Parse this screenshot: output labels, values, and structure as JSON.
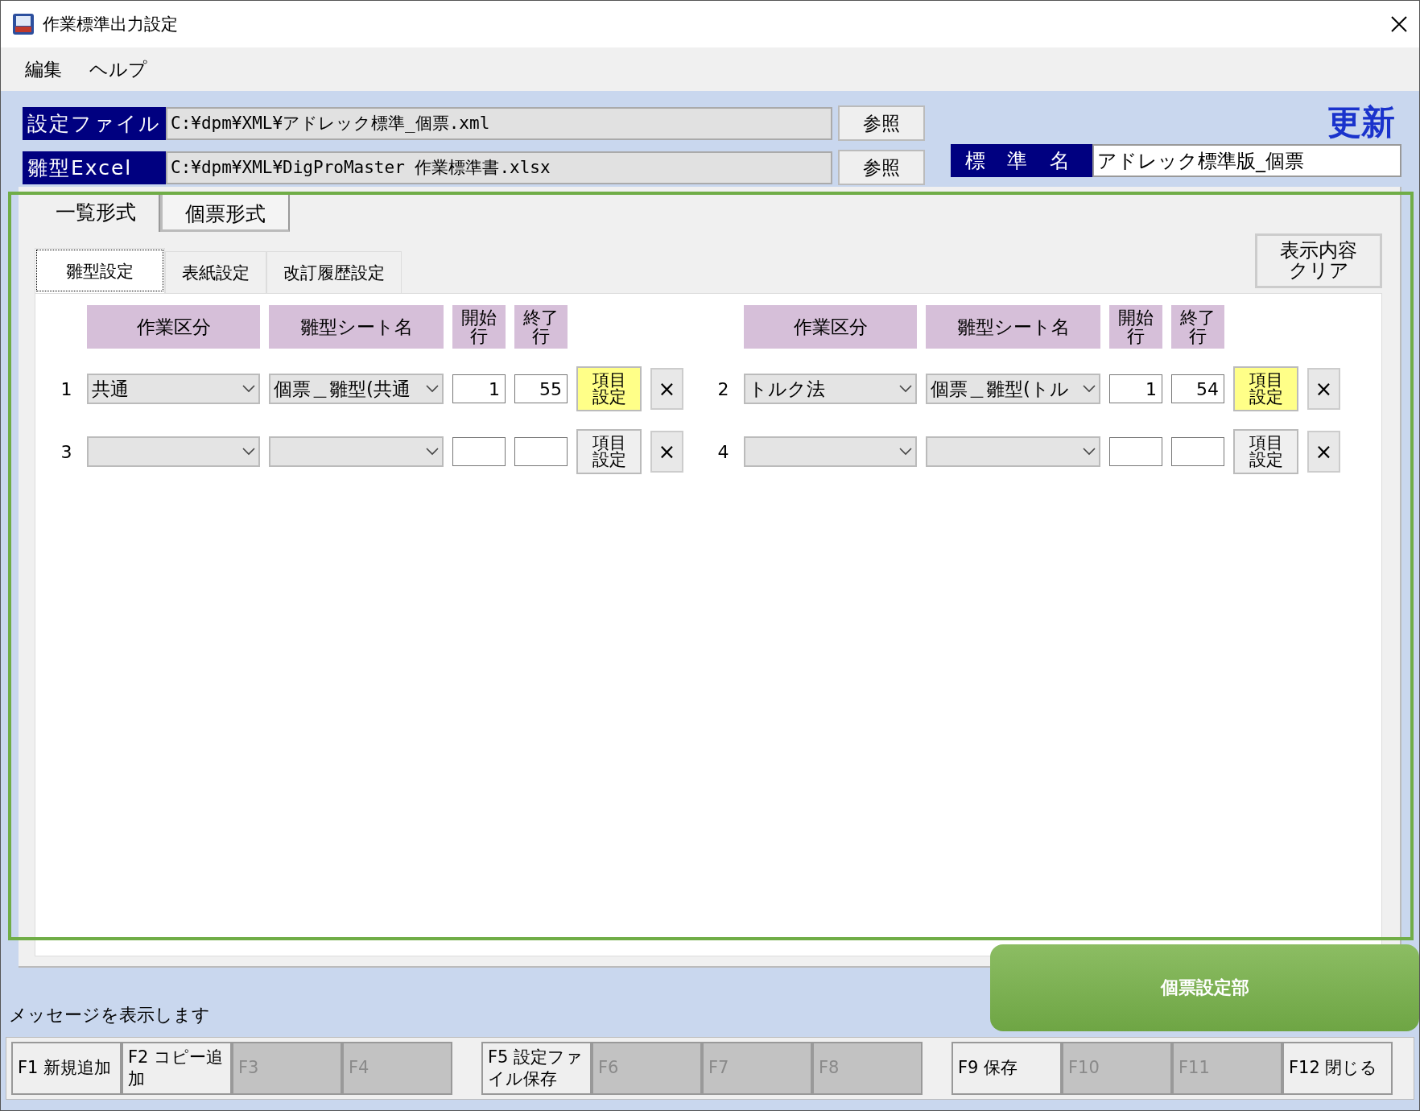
{
  "window": {
    "title": "作業標準出力設定"
  },
  "menu": [
    "編集",
    "ヘルプ"
  ],
  "file_rows": [
    {
      "label": "設定ファイル",
      "value": "C:¥dpm¥XML¥アドレック標準_個票.xml",
      "button": "参照"
    },
    {
      "label": "雛型Excel",
      "value": "C:¥dpm¥XML¥DigProMaster 作業標準書.xlsx",
      "button": "参照"
    }
  ],
  "update_label": "更新",
  "standard_name": {
    "label": "標 準 名",
    "value": "アドレック標準版_個票"
  },
  "view_tabs": [
    {
      "label": "一覧形式",
      "selected": false
    },
    {
      "label": "個票形式",
      "selected": true
    }
  ],
  "sub_tabs": [
    {
      "label": "雛型設定",
      "selected": true
    },
    {
      "label": "表紙設定",
      "selected": false
    },
    {
      "label": "改訂履歴設定",
      "selected": false
    }
  ],
  "clear_button": "表示内容クリア",
  "panels": [
    {
      "headers": [
        "作業区分",
        "雛型シート名",
        "開始行",
        "終了行"
      ],
      "rows": [
        {
          "number": "1",
          "category": "共通",
          "sheet": "個票＿雛型(共通",
          "start": "1",
          "end": "55",
          "item_button": "項目設定",
          "highlighted": true,
          "delete": "×"
        },
        {
          "number": "3",
          "category": "",
          "sheet": "",
          "start": "",
          "end": "",
          "item_button": "項目設定",
          "highlighted": false,
          "delete": "×"
        }
      ]
    },
    {
      "headers": [
        "作業区分",
        "雛型シート名",
        "開始行",
        "終了行"
      ],
      "rows": [
        {
          "number": "2",
          "category": "トルク法",
          "sheet": "個票＿雛型(トル",
          "start": "1",
          "end": "54",
          "item_button": "項目設定",
          "highlighted": true,
          "delete": "×"
        },
        {
          "number": "4",
          "category": "",
          "sheet": "",
          "start": "",
          "end": "",
          "item_button": "項目設定",
          "highlighted": false,
          "delete": "×"
        }
      ]
    }
  ],
  "message": "メッセージを表示します",
  "callout": "個票設定部",
  "function_key_groups": [
    [
      {
        "label": "F1 新規追加",
        "disabled": false
      },
      {
        "label": "F2 コピー追加",
        "disabled": false
      },
      {
        "label": "F3",
        "disabled": true
      },
      {
        "label": "F4",
        "disabled": true
      }
    ],
    [
      {
        "label": "F5 設定ファイル保存",
        "disabled": false
      },
      {
        "label": "F6",
        "disabled": true
      },
      {
        "label": "F7",
        "disabled": true
      },
      {
        "label": "F8",
        "disabled": true
      }
    ],
    [
      {
        "label": "F9 保存",
        "disabled": false
      },
      {
        "label": "F10",
        "disabled": true
      },
      {
        "label": "F11",
        "disabled": true
      },
      {
        "label": "F12 閉じる",
        "disabled": false
      }
    ]
  ]
}
